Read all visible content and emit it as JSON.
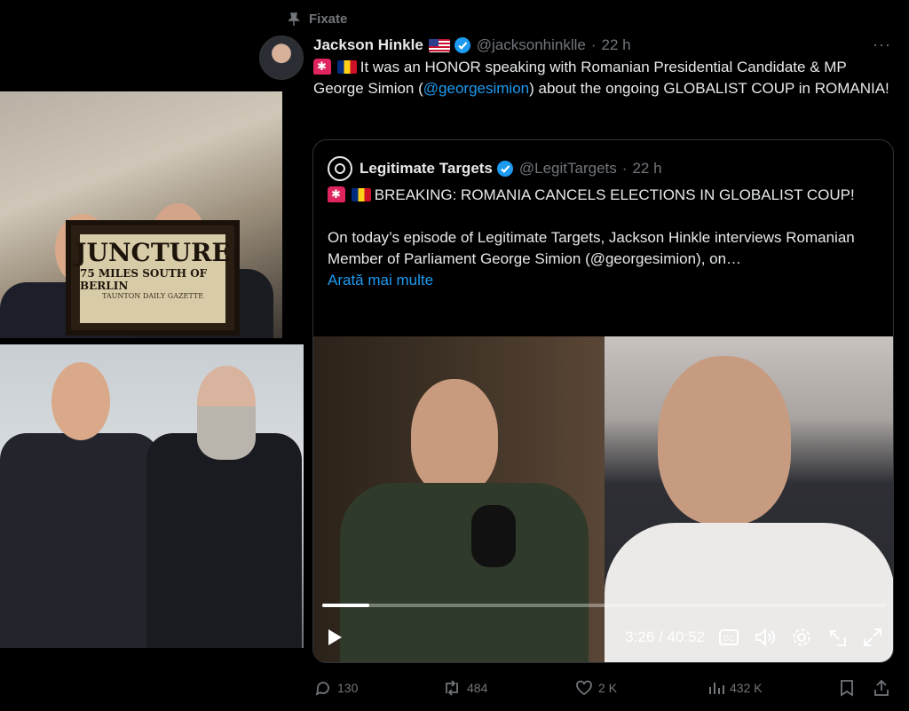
{
  "pinned_label": "Fixate",
  "tweet": {
    "author_name": "Jackson Hinkle",
    "author_handle": "@jacksonhinklle",
    "time": "22 h",
    "more_label": "···",
    "text_part1": "It was an HONOR speaking with Romanian Presidential Candidate & MP George Simion (",
    "mention": "@georgesimion",
    "text_part2": ") about the ongoing GLOBALIST COUP in ROMANIA!"
  },
  "quote": {
    "author_name": "Legitimate Targets",
    "author_handle": "@LegitTargets",
    "time": "22 h",
    "headline": "BREAKING: ROMANIA CANCELS ELECTIONS IN GLOBALIST COUP!",
    "body": "On today’s episode of Legitimate Targets, Jackson Hinkle interviews Romanian Member of Parliament George Simion (@georgesimion), on…",
    "show_more": "Arată mai multe"
  },
  "video": {
    "current_time": "3:26",
    "total_time": "40:52",
    "progress": 0.084
  },
  "newspaper": {
    "headline": "JUNCTURE",
    "subheadline": "75 MILES SOUTH OF BERLIN",
    "masthead": "TAUNTON DAILY GAZETTE"
  },
  "actions": {
    "replies": "130",
    "reposts": "484",
    "likes": "2 K",
    "views": "432 K"
  },
  "colors": {
    "accent": "#1d9bf0",
    "muted": "#71767b",
    "text": "#e7e9ea",
    "border": "#2f3336"
  }
}
